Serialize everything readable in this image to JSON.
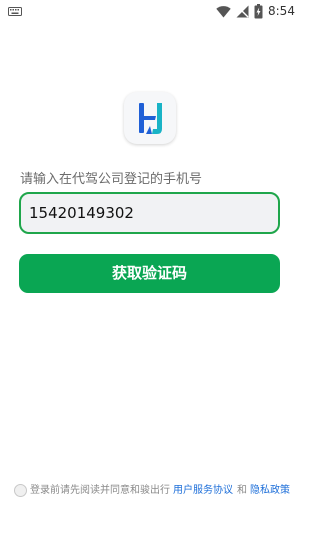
{
  "status_bar": {
    "time": "8:54",
    "icons": [
      "keyboard-icon",
      "wifi-icon",
      "signal-icon",
      "battery-charging-icon"
    ]
  },
  "logo": {
    "icon": "app-logo-icon",
    "colors": {
      "blue": "#1f5fd6",
      "teal": "#19b3c6",
      "background": "#f6f7f9"
    }
  },
  "login": {
    "prompt": "请输入在代驾公司登记的手机号",
    "phone_value": "15420149302",
    "get_code_label": "获取验证码"
  },
  "agreement": {
    "text": "登录前请先阅读并同意和骏出行",
    "terms_link": "用户服务协议",
    "and": "和",
    "privacy_link": "隐私政策",
    "checked": false
  },
  "colors": {
    "accent": "#0aa653",
    "field_border": "#1fa64b",
    "link": "#1e6fd9"
  }
}
